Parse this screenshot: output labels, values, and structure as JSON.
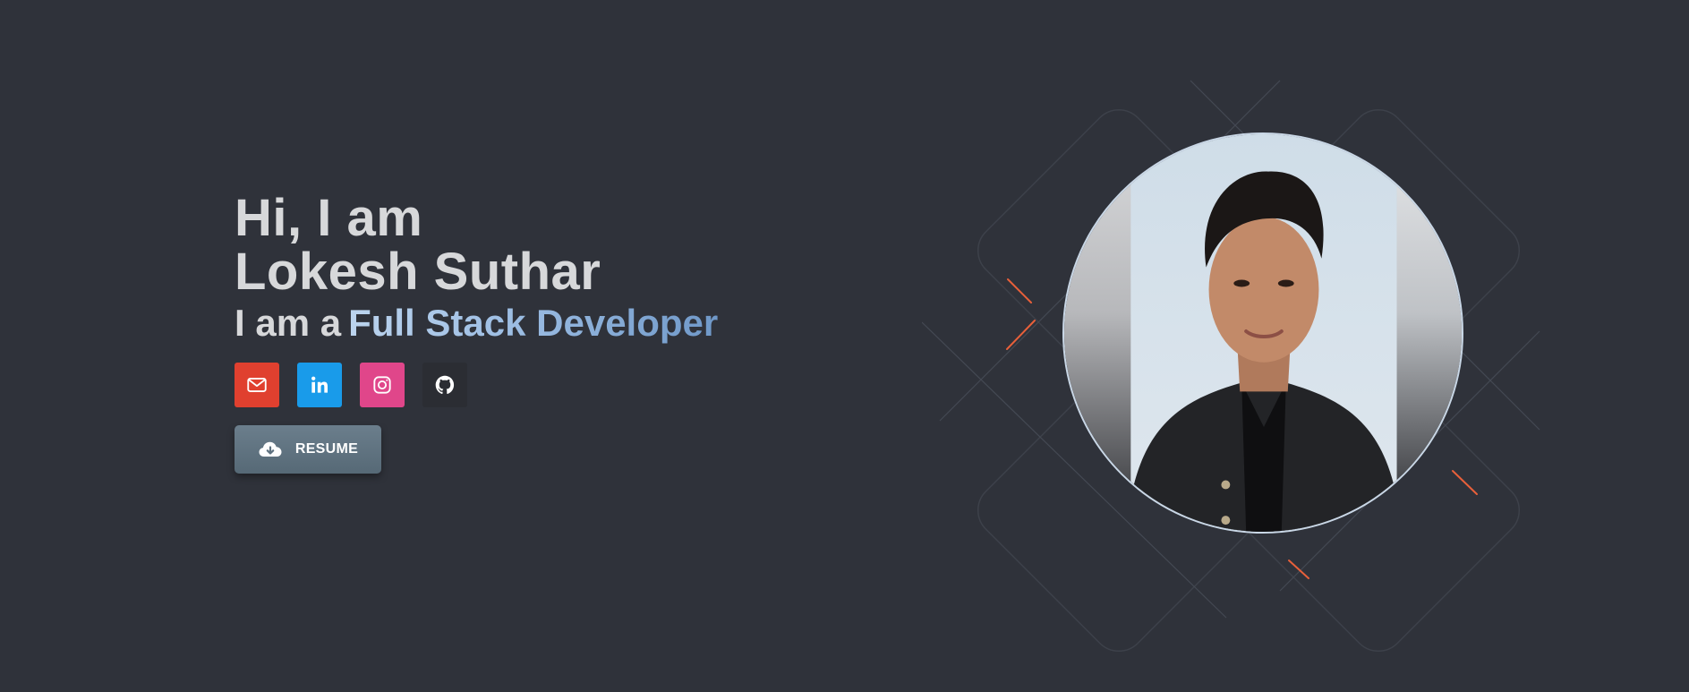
{
  "hero": {
    "greeting": "Hi, I am",
    "name": "Lokesh Suthar",
    "role_prefix": "I am a",
    "role": "Full Stack Developer"
  },
  "socials": [
    {
      "name": "email",
      "icon": "mail-icon",
      "color": "#e0402f"
    },
    {
      "name": "linkedin",
      "icon": "linkedin-icon",
      "color": "#199bea"
    },
    {
      "name": "instagram",
      "icon": "instagram-icon",
      "color": "#e0468a"
    },
    {
      "name": "github",
      "icon": "github-icon",
      "color": "#2b2d33"
    }
  ],
  "resume_button": {
    "label": "RESUME",
    "icon": "cloud-download-icon"
  },
  "colors": {
    "background": "#2f323a",
    "heading": "#d7d8da",
    "accent_gradient_start": "#bcd4ee",
    "accent_gradient_end": "#6f98c8",
    "decor_accent": "#e8603a"
  },
  "portrait": {
    "alt": "profile-photo"
  }
}
